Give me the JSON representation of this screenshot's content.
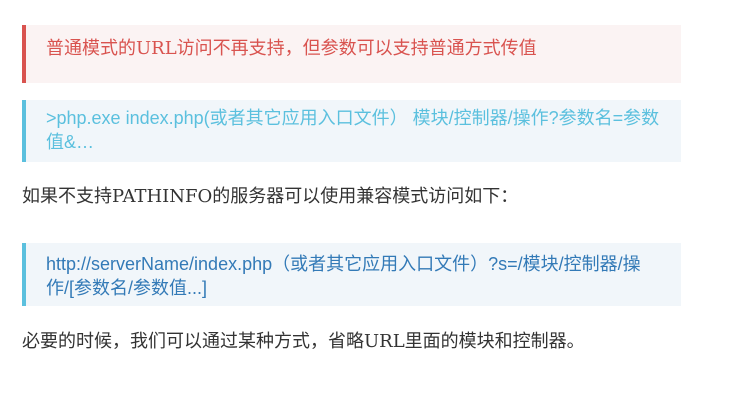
{
  "blocks": {
    "danger_note": "普通模式的URL访问不再支持，但参数可以支持普通方式传值",
    "cli_code_note": ">php.exe index.php(或者其它应用入口文件） 模块/控制器/操作?参数名=参数值&…",
    "intro_paragraph": "如果不支持PATHINFO的服务器可以使用兼容模式访问如下：",
    "compat_url_note": "http://serverName/index.php（或者其它应用入口文件）?s=/模块/控制器/操作/[参数名/参数值...]",
    "outro_paragraph": "必要的时候，我们可以通过某种方式，省略URL里面的模块和控制器。"
  },
  "colors": {
    "danger_text": "#d9534f",
    "danger_border": "#d9534f",
    "danger_bg": "#fbf3f3",
    "info_border": "#5bc0de",
    "info_bg": "#f1f6fa",
    "cli_text": "#5bc0de",
    "url_text": "#337ab7",
    "body_text": "#333333"
  }
}
